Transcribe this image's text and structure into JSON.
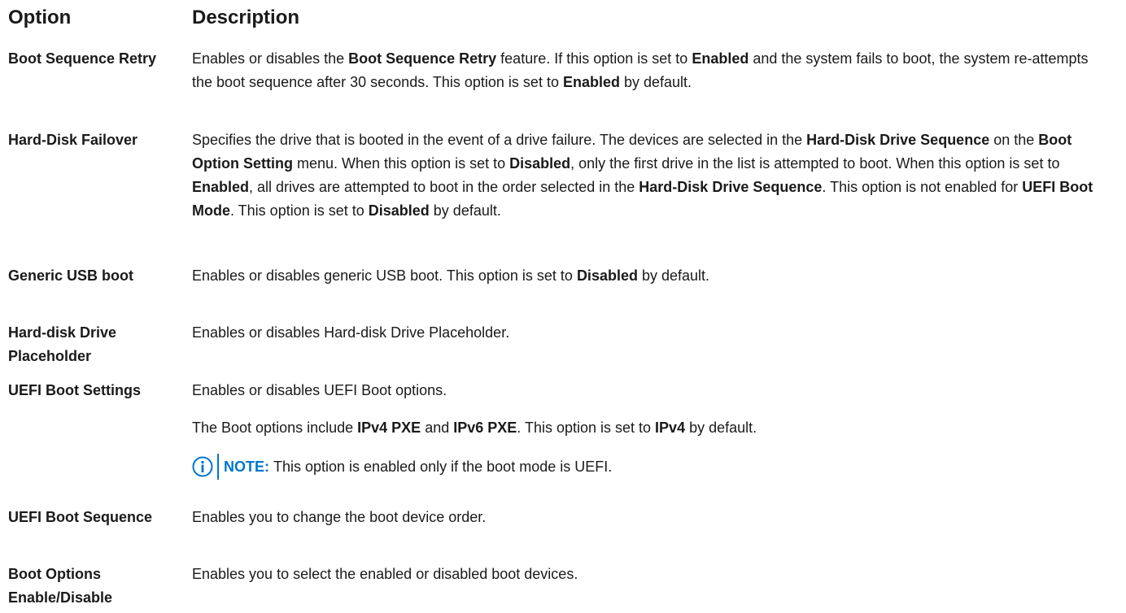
{
  "header": {
    "option": "Option",
    "description": "Description"
  },
  "rows": [
    {
      "option": "Boot Sequence Retry",
      "desc": [
        {
          "t": "Enables or disables the "
        },
        {
          "t": "Boot Sequence Retry",
          "b": true
        },
        {
          "t": " feature. If this option is set to "
        },
        {
          "t": "Enabled",
          "b": true
        },
        {
          "t": " and the system fails to boot, the system re-attempts the boot sequence after 30 seconds. This option is set to "
        },
        {
          "t": "Enabled",
          "b": true
        },
        {
          "t": " by default."
        }
      ]
    },
    {
      "option": "Hard-Disk Failover",
      "desc": [
        {
          "t": "Specifies the drive that is booted in the event of a drive failure. The devices are selected in the "
        },
        {
          "t": "Hard-Disk Drive Sequence",
          "b": true
        },
        {
          "t": " on the "
        },
        {
          "t": "Boot Option Setting",
          "b": true
        },
        {
          "t": " menu. When this option is set to "
        },
        {
          "t": "Disabled",
          "b": true
        },
        {
          "t": ", only the first drive in the list is attempted to boot. When this option is set to "
        },
        {
          "t": "Enabled",
          "b": true
        },
        {
          "t": ", all drives are attempted to boot in the order selected in the "
        },
        {
          "t": "Hard-Disk Drive Sequence",
          "b": true
        },
        {
          "t": ". This option is not enabled for "
        },
        {
          "t": "UEFI Boot Mode",
          "b": true
        },
        {
          "t": ". This option is set to "
        },
        {
          "t": "Disabled",
          "b": true
        },
        {
          "t": " by default."
        }
      ]
    },
    {
      "option": "Generic USB boot",
      "desc": [
        {
          "t": "Enables or disables generic USB boot. This option is set to "
        },
        {
          "t": "Disabled",
          "b": true
        },
        {
          "t": " by default."
        }
      ]
    },
    {
      "option": "Hard-disk Drive Placeholder",
      "desc": [
        {
          "t": "Enables or disables Hard-disk Drive Placeholder."
        }
      ]
    },
    {
      "option": "UEFI Boot Settings",
      "desc": [
        {
          "t": "Enables or disables UEFI Boot options."
        }
      ],
      "desc2": [
        {
          "t": "The Boot options include "
        },
        {
          "t": "IPv4 PXE",
          "b": true
        },
        {
          "t": " and "
        },
        {
          "t": "IPv6 PXE",
          "b": true
        },
        {
          "t": ". This option is set to "
        },
        {
          "t": "IPv4",
          "b": true
        },
        {
          "t": " by default."
        }
      ],
      "note": {
        "label": "NOTE:",
        "text": "This option is enabled only if the boot mode is UEFI."
      }
    },
    {
      "option": "UEFI Boot Sequence",
      "desc": [
        {
          "t": "Enables you to change the boot device order."
        }
      ]
    },
    {
      "option": "Boot Options Enable/Disable",
      "desc": [
        {
          "t": "Enables you to select the enabled or disabled boot devices."
        }
      ]
    }
  ],
  "icons": {
    "note": "info-icon"
  },
  "colors": {
    "note_accent": "#0076ce",
    "text": "#1a1a1a"
  }
}
